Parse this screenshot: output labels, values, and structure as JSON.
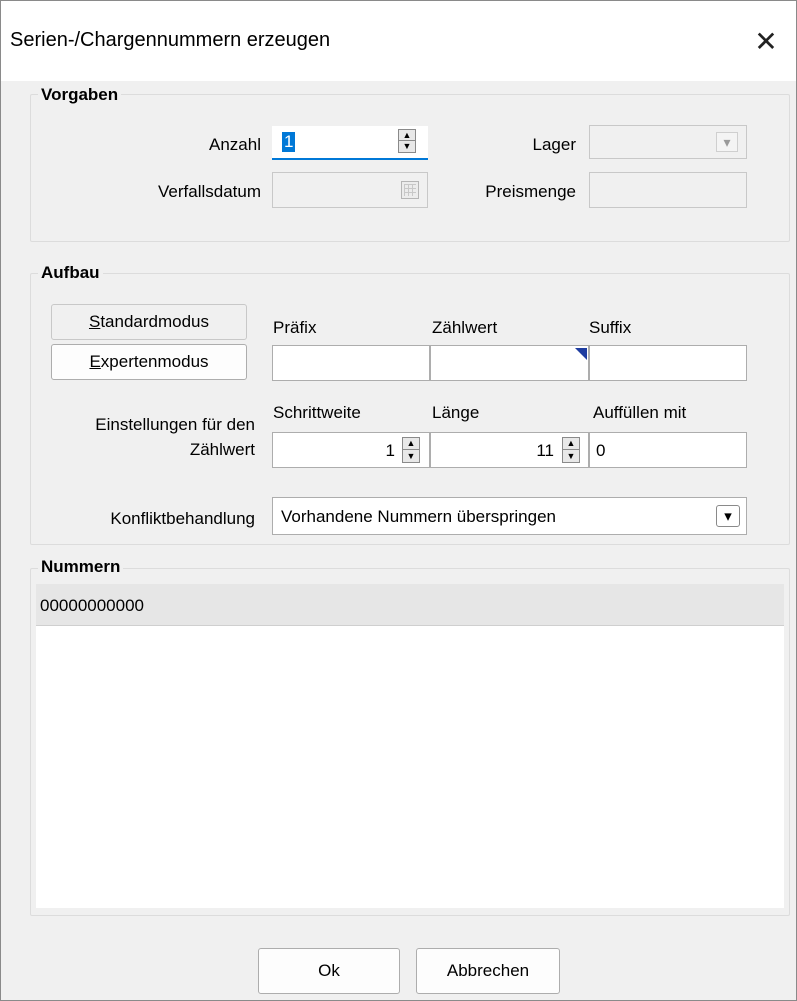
{
  "window": {
    "title": "Serien-/Chargennummern erzeugen",
    "close": "✕"
  },
  "vorgaben": {
    "title": "Vorgaben",
    "anzahl_label": "Anzahl",
    "anzahl_value": "1",
    "lager_label": "Lager",
    "verfallsdatum_label": "Verfallsdatum",
    "preismenge_label": "Preismenge"
  },
  "aufbau": {
    "title": "Aufbau",
    "standard_button": {
      "hotkey": "S",
      "rest": "tandardmodus"
    },
    "experten_button": {
      "hotkey": "E",
      "rest": "xpertenmodus"
    },
    "praefix_label": "Präfix",
    "zaehlwert_label": "Zählwert",
    "suffix_label": "Suffix",
    "einstellungen_label_1": "Einstellungen für den",
    "einstellungen_label_2": "Zählwert",
    "schrittweite_label": "Schrittweite",
    "laenge_label": "Länge",
    "auffuellen_label": "Auffüllen mit",
    "schrittweite_value": "1",
    "laenge_value": "11",
    "auffuellen_value": "0",
    "konflikt_label": "Konfliktbehandlung",
    "konflikt_value": "Vorhandene Nummern überspringen"
  },
  "nummern": {
    "title": "Nummern",
    "rows": [
      "00000000000"
    ]
  },
  "footer": {
    "ok_label": "Ok",
    "cancel_label": "Abbrechen"
  },
  "icons": {
    "spin_up": "▲",
    "spin_down": "▼",
    "dropdown": "▾",
    "calendar": "calendar-icon"
  },
  "colors": {
    "focus_accent": "#0078d7",
    "selection": "#0078d7",
    "indicator": "#1e3ca0"
  }
}
